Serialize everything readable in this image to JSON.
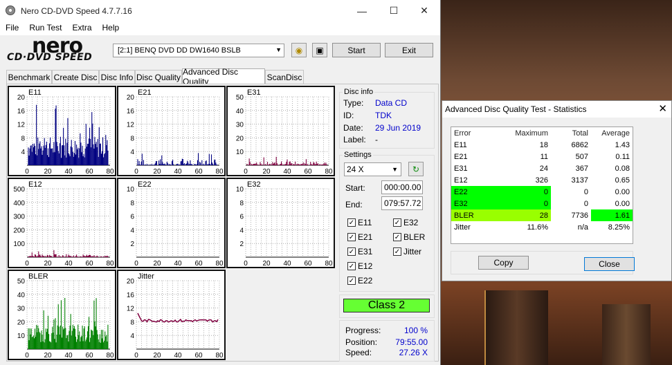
{
  "main": {
    "title": "Nero CD-DVD Speed 4.7.7.16",
    "menu": [
      "File",
      "Run Test",
      "Extra",
      "Help"
    ],
    "logo_text": "nero",
    "logo_sub": "CD·DVD SPEED",
    "drive": "[2:1]   BENQ DVD DD DW1640 BSLB",
    "start_label": "Start",
    "exit_label": "Exit",
    "tabs": [
      "Benchmark",
      "Create Disc",
      "Disc Info",
      "Disc Quality",
      "Advanced Disc Quality",
      "ScanDisc"
    ],
    "active_tab": "Advanced Disc Quality"
  },
  "disc_info": {
    "heading": "Disc info",
    "type_label": "Type:",
    "type": "Data CD",
    "id_label": "ID:",
    "id": "TDK",
    "date_label": "Date:",
    "date": "29 Jun 2019",
    "label_label": "Label:",
    "label": "-"
  },
  "settings": {
    "heading": "Settings",
    "speed": "24 X",
    "start_label": "Start:",
    "start": "000:00.00",
    "end_label": "End:",
    "end": "079:57.72",
    "checks": [
      {
        "label": "E11",
        "checked": true
      },
      {
        "label": "E32",
        "checked": true
      },
      {
        "label": "E21",
        "checked": true
      },
      {
        "label": "BLER",
        "checked": true
      },
      {
        "label": "E31",
        "checked": true
      },
      {
        "label": "Jitter",
        "checked": true
      },
      {
        "label": "E12",
        "checked": true
      },
      {
        "label": "E22",
        "checked": true
      }
    ]
  },
  "class_label": "Class 2",
  "progress": {
    "progress_label": "Progress:",
    "progress": "100 %",
    "position_label": "Position:",
    "position": "79:55.00",
    "speed_label": "Speed:",
    "speed": "27.26 X"
  },
  "chart_data": [
    {
      "type": "bar",
      "title": "E11",
      "x": [
        0,
        80
      ],
      "xticks": [
        "0",
        "20",
        "40",
        "60",
        "80"
      ],
      "yticks": [
        "20",
        "16",
        "12",
        "8",
        "4"
      ],
      "ylim": [
        0,
        20
      ],
      "color": "#000080",
      "level": 0.35
    },
    {
      "type": "bar",
      "title": "E21",
      "x": [
        0,
        80
      ],
      "xticks": [
        "0",
        "20",
        "40",
        "60",
        "80"
      ],
      "yticks": [
        "20",
        "16",
        "12",
        "8",
        "4"
      ],
      "ylim": [
        0,
        20
      ],
      "color": "#000080",
      "level": 0.08
    },
    {
      "type": "bar",
      "title": "E31",
      "x": [
        0,
        80
      ],
      "xticks": [
        "0",
        "20",
        "40",
        "60",
        "80"
      ],
      "yticks": [
        "50",
        "40",
        "30",
        "20",
        "10"
      ],
      "ylim": [
        0,
        50
      ],
      "color": "#800040",
      "level": 0.05
    },
    {
      "type": "bar",
      "title": "E12",
      "x": [
        0,
        80
      ],
      "xticks": [
        "0",
        "20",
        "40",
        "60",
        "80"
      ],
      "yticks": [
        "500",
        "400",
        "300",
        "200",
        "100"
      ],
      "ylim": [
        0,
        500
      ],
      "color": "#800040",
      "level": 0.04
    },
    {
      "type": "bar",
      "title": "E22",
      "x": [
        0,
        80
      ],
      "xticks": [
        "0",
        "20",
        "40",
        "60",
        "80"
      ],
      "yticks": [
        "10",
        "8",
        "6",
        "4",
        "2"
      ],
      "ylim": [
        0,
        10
      ],
      "color": "#800040",
      "level": 0
    },
    {
      "type": "bar",
      "title": "E32",
      "x": [
        0,
        80
      ],
      "xticks": [
        "0",
        "20",
        "40",
        "60",
        "80"
      ],
      "yticks": [
        "10",
        "8",
        "6",
        "4",
        "2"
      ],
      "ylim": [
        0,
        10
      ],
      "color": "#800040",
      "level": 0
    },
    {
      "type": "bar",
      "title": "BLER",
      "x": [
        0,
        80
      ],
      "xticks": [
        "0",
        "20",
        "40",
        "60",
        "80"
      ],
      "yticks": [
        "50",
        "40",
        "30",
        "20",
        "10"
      ],
      "ylim": [
        0,
        50
      ],
      "color": "#008000",
      "level": 0.3
    },
    {
      "type": "line",
      "title": "Jitter",
      "x": [
        0,
        80
      ],
      "xticks": [
        "0",
        "20",
        "40",
        "60",
        "80"
      ],
      "yticks": [
        "20",
        "16",
        "12",
        "8",
        "4"
      ],
      "ylim": [
        0,
        20
      ],
      "color": "#800040",
      "level": 8.3
    }
  ],
  "stats": {
    "title": "Advanced Disc Quality Test - Statistics",
    "headers": [
      "Error",
      "Maximum",
      "Total",
      "Average"
    ],
    "rows": [
      [
        "E11",
        "18",
        "6862",
        "1.43"
      ],
      [
        "E21",
        "11",
        "507",
        "0.11"
      ],
      [
        "E31",
        "24",
        "367",
        "0.08"
      ],
      [
        "E12",
        "326",
        "3137",
        "0.65"
      ],
      [
        "E22",
        "0",
        "0",
        "0.00"
      ],
      [
        "E32",
        "0",
        "0",
        "0.00"
      ],
      [
        "BLER",
        "28",
        "7736",
        "1.61"
      ],
      [
        "Jitter",
        "11.6%",
        "n/a",
        "8.25%"
      ]
    ],
    "copy_label": "Copy",
    "close_label": "Close"
  }
}
